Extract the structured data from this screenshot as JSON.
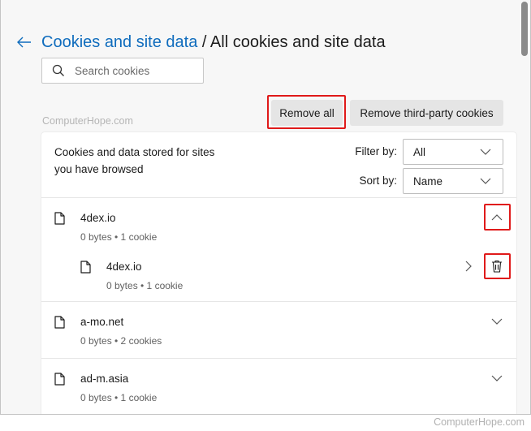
{
  "header": {
    "back_icon": "arrow-left-icon",
    "breadcrumb_parent": "Cookies and site data",
    "separator": " / ",
    "title": "All cookies and site data"
  },
  "search": {
    "icon": "search-icon",
    "placeholder": "Search cookies",
    "value": ""
  },
  "watermark": "ComputerHope.com",
  "actions": {
    "remove_all": "Remove all",
    "remove_third_party": "Remove third-party cookies"
  },
  "panel": {
    "description": "Cookies and data stored for sites you have browsed",
    "filter": {
      "label": "Filter by:",
      "value": "All"
    },
    "sort": {
      "label": "Sort by:",
      "value": "Name"
    }
  },
  "sites": [
    {
      "name": "4dex.io",
      "meta": "0 bytes • 1 cookie",
      "expanded": true,
      "children": [
        {
          "name": "4dex.io",
          "meta": "0 bytes • 1 cookie"
        }
      ]
    },
    {
      "name": "a-mo.net",
      "meta": "0 bytes • 2 cookies",
      "expanded": false
    },
    {
      "name": "ad-m.asia",
      "meta": "0 bytes • 1 cookie",
      "expanded": false
    }
  ],
  "colors": {
    "accent": "#0f6cbd",
    "highlight": "#e01a1a",
    "page_bg": "#f7f7f7"
  }
}
